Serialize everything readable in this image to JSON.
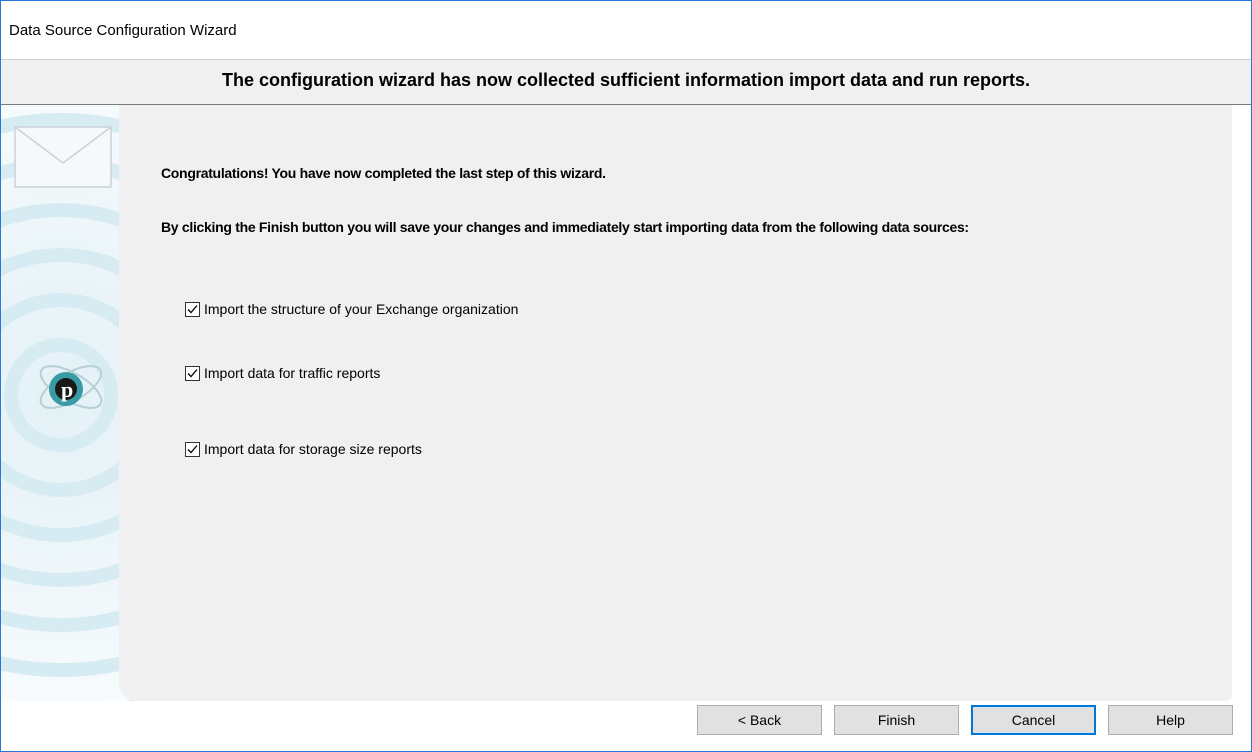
{
  "window": {
    "title": "Data Source Configuration Wizard"
  },
  "header": {
    "text": "The configuration wizard has now collected sufficient information import data and run reports."
  },
  "content": {
    "congrats": "Congratulations! You have now completed the last step of this wizard.",
    "finish_info": "By clicking the Finish button you will save your changes and immediately start importing data from the following data sources:",
    "options": [
      {
        "label": "Import the structure of your Exchange organization",
        "checked": true
      },
      {
        "label": "Import data for traffic reports",
        "checked": true
      },
      {
        "label": "Import data for storage size reports",
        "checked": true
      }
    ]
  },
  "buttons": {
    "back": "< Back",
    "finish": "Finish",
    "cancel": "Cancel",
    "help": "Help"
  },
  "colors": {
    "accent": "#0078d7",
    "logo_teal": "#3a9aa6",
    "logo_dark": "#1a1a1a"
  },
  "icons": {
    "side_art": "envelope-and-logo-graphic",
    "logo": "p-logo-icon",
    "envelope": "envelope-icon",
    "checkbox": "checkmark-icon"
  }
}
